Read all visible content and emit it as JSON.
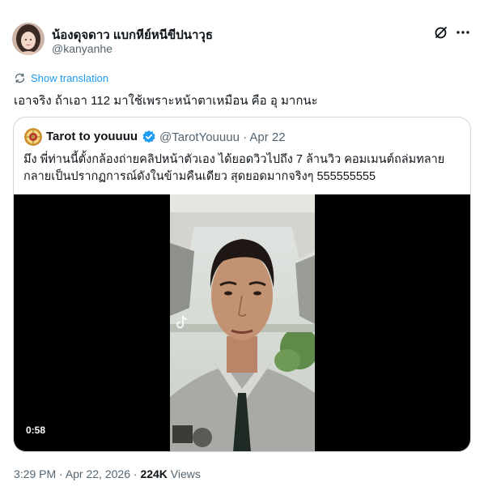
{
  "post": {
    "display_name": "น้องดุจดาว แบกหีย์หนีขีปนาวุธ",
    "handle": "@kanyanhe",
    "translate_label": "Show translation",
    "text": "เอาจริง ถ้าเอา 112 มาใช้เพราะหน้าตาเหมือน คือ อุ มากนะ",
    "time": "3:29 PM",
    "separator": " · ",
    "date": "Apr 22, 2026",
    "views_count": "224K",
    "views_label": " Views"
  },
  "quote": {
    "name": "Tarot to youuuu",
    "handle_date": "@TarotYouuuu · Apr 22",
    "text_lines": [
      "มึง พี่ท่านนี้ตั้งกล้องถ่ายคลิปหน้าตัวเอง ได้ยอดวิวไปถึง 7 ล้านวิว คอมเมนต์ถล่มทลาย",
      "กลายเป็นปรากฏการณ์ดังในข้ามคืนเดียว สุดยอดมากจริงๆ 555555555"
    ],
    "video_duration": "0:58"
  },
  "icons": {
    "grok": "grok-icon",
    "more": "more-icon",
    "translate": "translate-icon",
    "verified": "verified-badge-icon",
    "tiktok": "tiktok-watermark-icon"
  },
  "colors": {
    "link": "#1d9bf0",
    "secondary_text": "#536471",
    "border": "#cfd9de",
    "video_bg": "#000000"
  }
}
